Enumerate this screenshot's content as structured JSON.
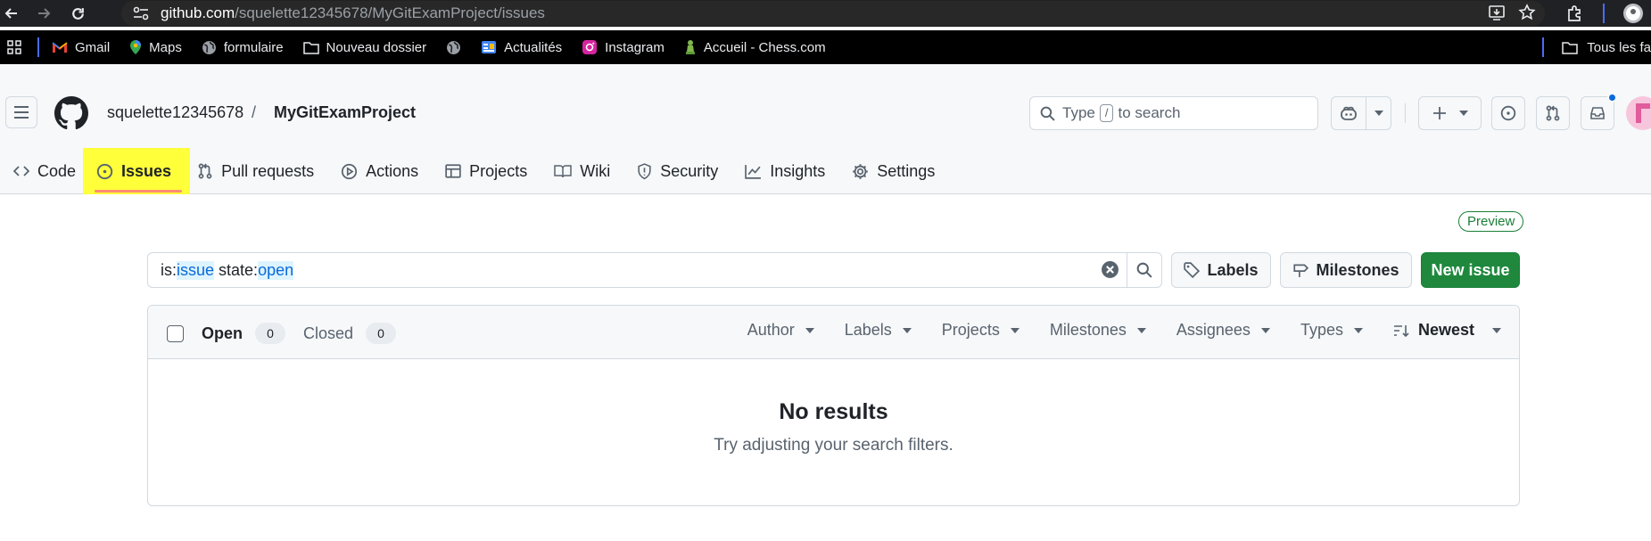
{
  "browser": {
    "url_domain": "github.com",
    "url_path": "/squelette12345678/MyGitExamProject/issues"
  },
  "bookmarks": {
    "items": [
      {
        "label": "Gmail",
        "icon": "gmail-icon"
      },
      {
        "label": "Maps",
        "icon": "maps-icon"
      },
      {
        "label": "formulaire",
        "icon": "globe-icon"
      },
      {
        "label": "Nouveau dossier",
        "icon": "folder-icon"
      },
      {
        "label": "",
        "icon": "globe-icon"
      },
      {
        "label": "Actualités",
        "icon": "news-icon"
      },
      {
        "label": "Instagram",
        "icon": "instagram-icon"
      },
      {
        "label": "Accueil - Chess.com",
        "icon": "chess-icon"
      }
    ],
    "all_bookmarks": "Tous les fa"
  },
  "header": {
    "owner": "squelette12345678",
    "separator": "/",
    "repo": "MyGitExamProject",
    "search_prefix": "Type",
    "search_key": "/",
    "search_suffix": "to search"
  },
  "tabs": [
    {
      "label": "Code",
      "icon": "code-icon"
    },
    {
      "label": "Issues",
      "icon": "issue-opened-icon"
    },
    {
      "label": "Pull requests",
      "icon": "pull-request-icon"
    },
    {
      "label": "Actions",
      "icon": "play-icon"
    },
    {
      "label": "Projects",
      "icon": "table-icon"
    },
    {
      "label": "Wiki",
      "icon": "book-icon"
    },
    {
      "label": "Security",
      "icon": "shield-icon"
    },
    {
      "label": "Insights",
      "icon": "graph-icon"
    },
    {
      "label": "Settings",
      "icon": "gear-icon"
    }
  ],
  "main": {
    "preview_badge": "Preview",
    "query": {
      "k1": "is:",
      "v1": "issue",
      "k2": " state:",
      "v2": "open"
    },
    "labels_button": "Labels",
    "milestones_button": "Milestones",
    "new_issue_button": "New issue",
    "open_label": "Open",
    "open_count": "0",
    "closed_label": "Closed",
    "closed_count": "0",
    "filters": [
      "Author",
      "Labels",
      "Projects",
      "Milestones",
      "Assignees",
      "Types"
    ],
    "sort_label": "Newest",
    "empty_title": "No results",
    "empty_subtitle": "Try adjusting your search filters."
  },
  "colors": {
    "accent_green": "#1f883d",
    "highlight_yellow": "#ffff3a",
    "link_blue": "#0969da",
    "tab_underline": "#fd8c73"
  }
}
